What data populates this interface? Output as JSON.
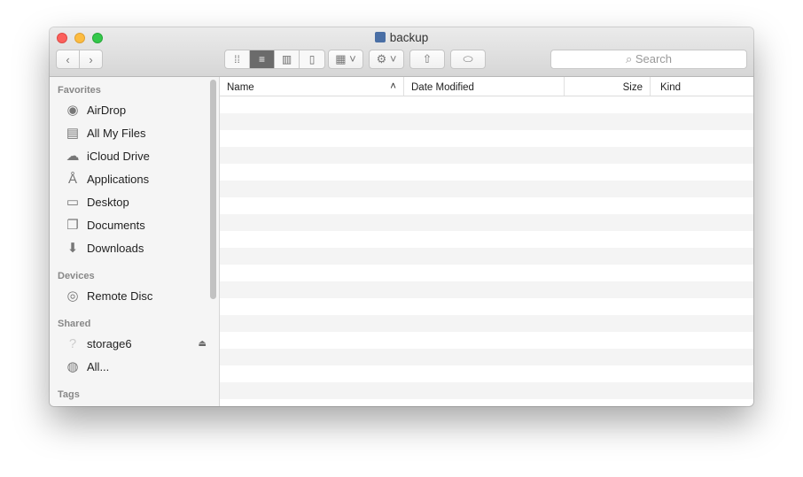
{
  "window": {
    "title": "backup"
  },
  "toolbar": {
    "search_placeholder": "Search"
  },
  "sidebar": {
    "sections": [
      {
        "label": "Favorites",
        "items": [
          {
            "label": "AirDrop",
            "icon": "airdrop-icon"
          },
          {
            "label": "All My Files",
            "icon": "all-files-icon"
          },
          {
            "label": "iCloud Drive",
            "icon": "cloud-icon"
          },
          {
            "label": "Applications",
            "icon": "applications-icon"
          },
          {
            "label": "Desktop",
            "icon": "desktop-icon"
          },
          {
            "label": "Documents",
            "icon": "documents-icon"
          },
          {
            "label": "Downloads",
            "icon": "downloads-icon"
          }
        ]
      },
      {
        "label": "Devices",
        "items": [
          {
            "label": "Remote Disc",
            "icon": "disc-icon"
          }
        ]
      },
      {
        "label": "Shared",
        "items": [
          {
            "label": "storage6",
            "icon": "question-icon"
          },
          {
            "label": "All...",
            "icon": "network-icon"
          }
        ]
      },
      {
        "label": "Tags",
        "items": []
      }
    ]
  },
  "columns": [
    "Name",
    "Date Modified",
    "Size",
    "Kind"
  ]
}
